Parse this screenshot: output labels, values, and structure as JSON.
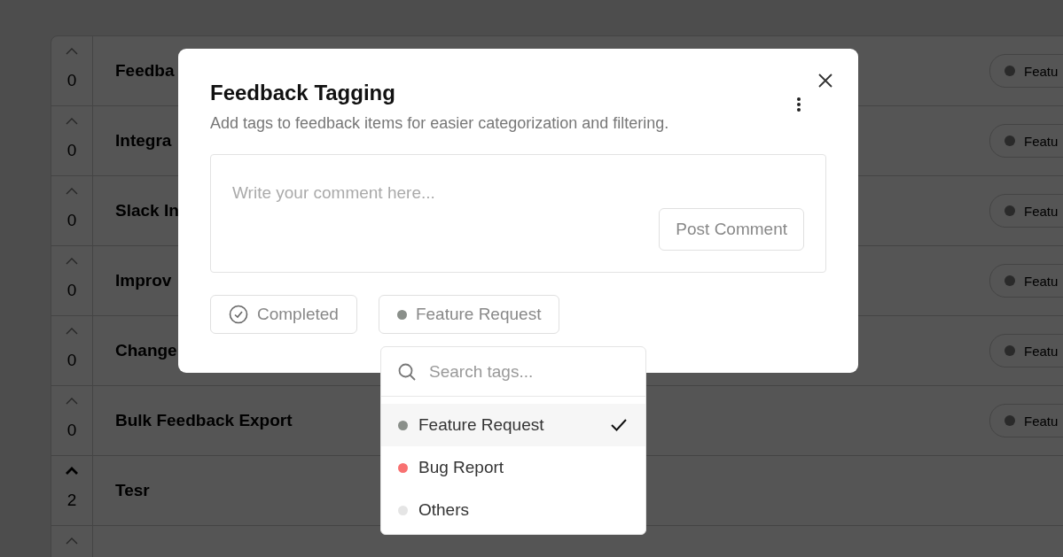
{
  "feedback_list": {
    "rows": [
      {
        "votes": "0",
        "upvoted": false,
        "title": "Feedba",
        "tag": {
          "label": "Featu"
        }
      },
      {
        "votes": "0",
        "upvoted": false,
        "title": "Integra",
        "tag": {
          "label": "Featu"
        }
      },
      {
        "votes": "0",
        "upvoted": false,
        "title": "Slack In",
        "tag": {
          "label": "Featu"
        }
      },
      {
        "votes": "0",
        "upvoted": false,
        "title": "Improv",
        "tag": {
          "label": "Featu"
        }
      },
      {
        "votes": "0",
        "upvoted": false,
        "title": "Change",
        "tag": {
          "label": "Featu"
        }
      },
      {
        "votes": "0",
        "upvoted": false,
        "title": "Bulk Feedback Export",
        "tag": {
          "label": "Featu"
        }
      },
      {
        "votes": "2",
        "upvoted": true,
        "title": "Tesr"
      },
      {
        "upvoted": false
      }
    ]
  },
  "modal": {
    "title": "Feedback Tagging",
    "subtitle": "Add tags to feedback items for easier categorization and filtering.",
    "comment": {
      "placeholder": "Write your comment here...",
      "button": "Post Comment"
    },
    "status_chip": {
      "label": "Completed"
    },
    "tag_chip": {
      "label": "Feature Request",
      "color": "#8a8f8a"
    }
  },
  "tag_menu": {
    "search_placeholder": "Search tags...",
    "options": [
      {
        "label": "Feature Request",
        "color": "#8a8f8a",
        "selected": true
      },
      {
        "label": "Bug Report",
        "color": "#f87171",
        "selected": false
      },
      {
        "label": "Others",
        "color": "#e5e5e5",
        "selected": false
      }
    ]
  }
}
